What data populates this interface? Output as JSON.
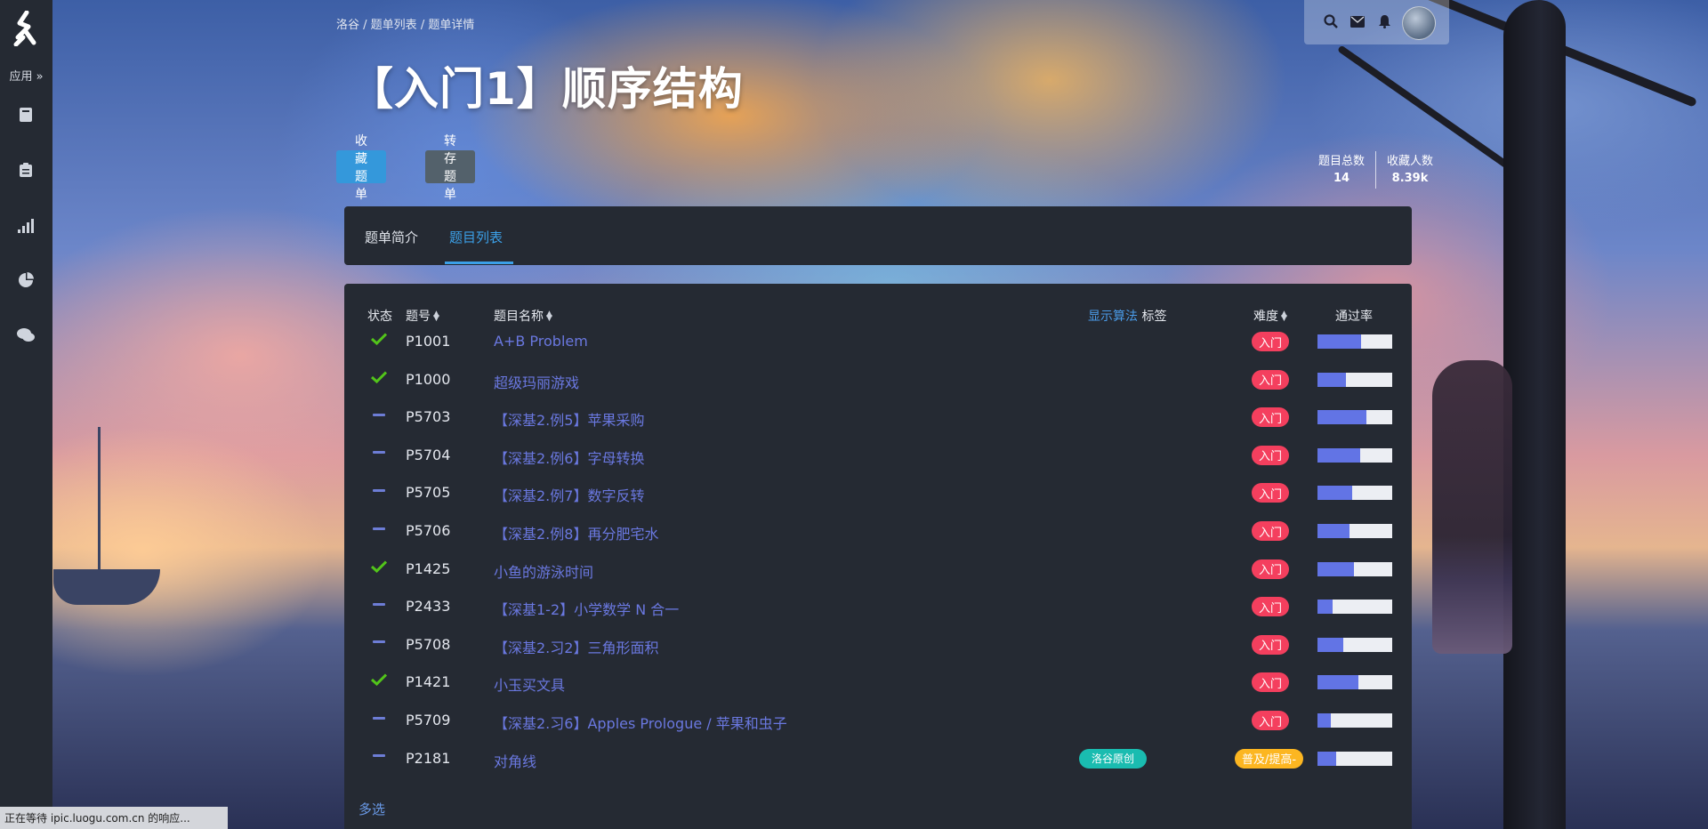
{
  "sidebar": {
    "logo_icon": "luogu-logo-icon",
    "apps_label": "应用 »",
    "icons": [
      "book-icon",
      "clipboard-icon",
      "signal-bars-icon",
      "pie-chart-icon",
      "comments-icon"
    ]
  },
  "topbar": {
    "icons": [
      "search-icon",
      "envelope-icon",
      "bell-icon"
    ],
    "avatar": "avatar"
  },
  "breadcrumb": {
    "items": [
      "洛谷",
      "题单列表",
      "题单详情"
    ],
    "separator": " / "
  },
  "header": {
    "title": "【入门1】顺序结构",
    "favorite_button": "收藏题单",
    "save_button": "转存题单",
    "stats": {
      "total_label": "题目总数",
      "total_value": "14",
      "fav_label": "收藏人数",
      "fav_value": "8.39k"
    }
  },
  "tabs": {
    "intro": "题单简介",
    "list": "题目列表",
    "active": "list"
  },
  "table": {
    "columns": {
      "status": "状态",
      "id": "题号",
      "name": "题目名称",
      "show_algo": "显示算法",
      "tags": "标签",
      "difficulty": "难度",
      "pass_rate": "通过率"
    },
    "rows": [
      {
        "status": "passed",
        "id": "P1001",
        "name": "A+B Problem",
        "tag": "",
        "difficulty": "入门",
        "rate": 0.58
      },
      {
        "status": "passed",
        "id": "P1000",
        "name": "超级玛丽游戏",
        "tag": "",
        "difficulty": "入门",
        "rate": 0.38
      },
      {
        "status": "none",
        "id": "P5703",
        "name": "【深基2.例5】苹果采购",
        "tag": "",
        "difficulty": "入门",
        "rate": 0.66
      },
      {
        "status": "none",
        "id": "P5704",
        "name": "【深基2.例6】字母转换",
        "tag": "",
        "difficulty": "入门",
        "rate": 0.57
      },
      {
        "status": "none",
        "id": "P5705",
        "name": "【深基2.例7】数字反转",
        "tag": "",
        "difficulty": "入门",
        "rate": 0.46
      },
      {
        "status": "none",
        "id": "P5706",
        "name": "【深基2.例8】再分肥宅水",
        "tag": "",
        "difficulty": "入门",
        "rate": 0.43
      },
      {
        "status": "passed",
        "id": "P1425",
        "name": "小鱼的游泳时间",
        "tag": "",
        "difficulty": "入门",
        "rate": 0.49
      },
      {
        "status": "none",
        "id": "P2433",
        "name": "【深基1-2】小学数学 N 合一",
        "tag": "",
        "difficulty": "入门",
        "rate": 0.2
      },
      {
        "status": "none",
        "id": "P5708",
        "name": "【深基2.习2】三角形面积",
        "tag": "",
        "difficulty": "入门",
        "rate": 0.35
      },
      {
        "status": "passed",
        "id": "P1421",
        "name": "小玉买文具",
        "tag": "",
        "difficulty": "入门",
        "rate": 0.55
      },
      {
        "status": "none",
        "id": "P5709",
        "name": "【深基2.习6】Apples Prologue / 苹果和虫子",
        "tag": "",
        "difficulty": "入门",
        "rate": 0.18
      },
      {
        "status": "none",
        "id": "P2181",
        "name": "对角线",
        "tag": "洛谷原创",
        "difficulty": "普及/提高-",
        "rate": 0.25
      }
    ],
    "multi_select": "多选"
  },
  "colors": {
    "accent": "#3498db",
    "link": "#6a78e0",
    "difficulty_intro": "#f43f5e",
    "difficulty_popular": "#fcb621",
    "tag_original": "#1abcb0",
    "passed": "#52c41a"
  },
  "status_bar": "正在等待 ipic.luogu.com.cn 的响应..."
}
